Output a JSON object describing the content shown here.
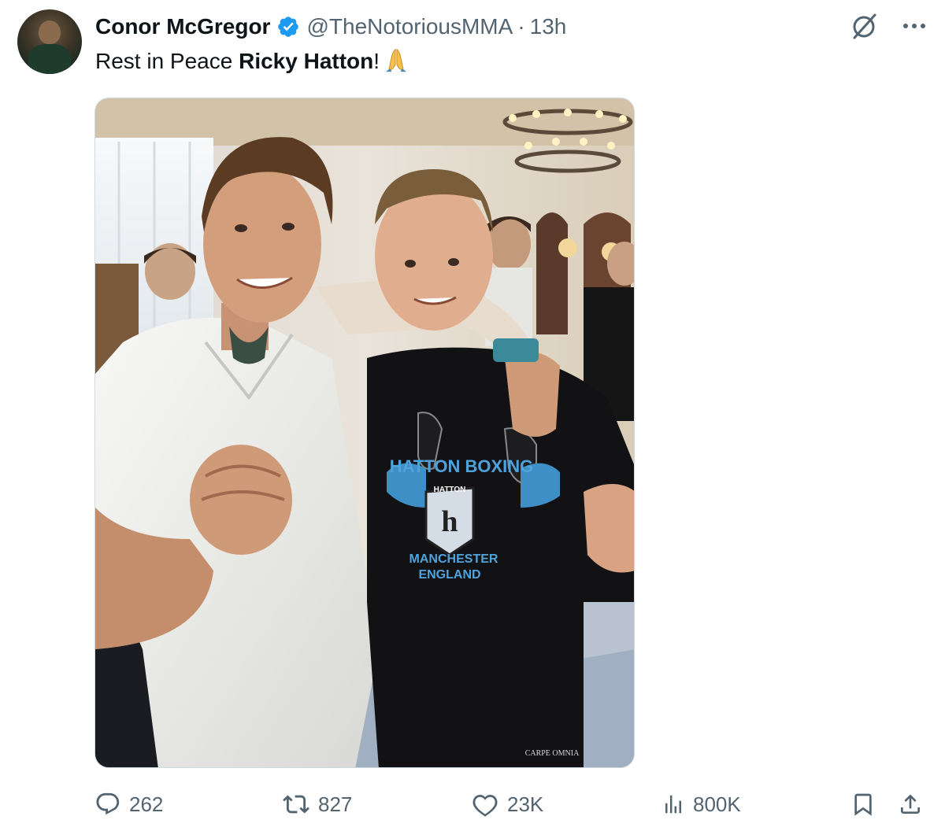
{
  "author": {
    "name": "Conor McGregor",
    "handle": "@TheNotoriousMMA",
    "separator": "·",
    "time": "13h",
    "avatar_icon": "profile-photo",
    "verified_icon": "verified-badge-icon"
  },
  "tweet": {
    "text_prefix": "Rest in Peace ",
    "mention_bold": "Ricky Hatton",
    "text_suffix": "!",
    "emoji": "folded-hands"
  },
  "photo": {
    "description_icon": "photo",
    "shirt_lines": [
      "HATTON BOXING",
      "MANCHESTER",
      "ENGLAND"
    ],
    "shirt_badge": "HATTON",
    "pants_text": "CARPE OMNIA"
  },
  "actions": {
    "replies": "262",
    "reposts": "827",
    "likes": "23K",
    "views": "800K"
  },
  "colors": {
    "accent": "#1d9bf0",
    "muted": "#536471",
    "text": "#0f1419"
  }
}
